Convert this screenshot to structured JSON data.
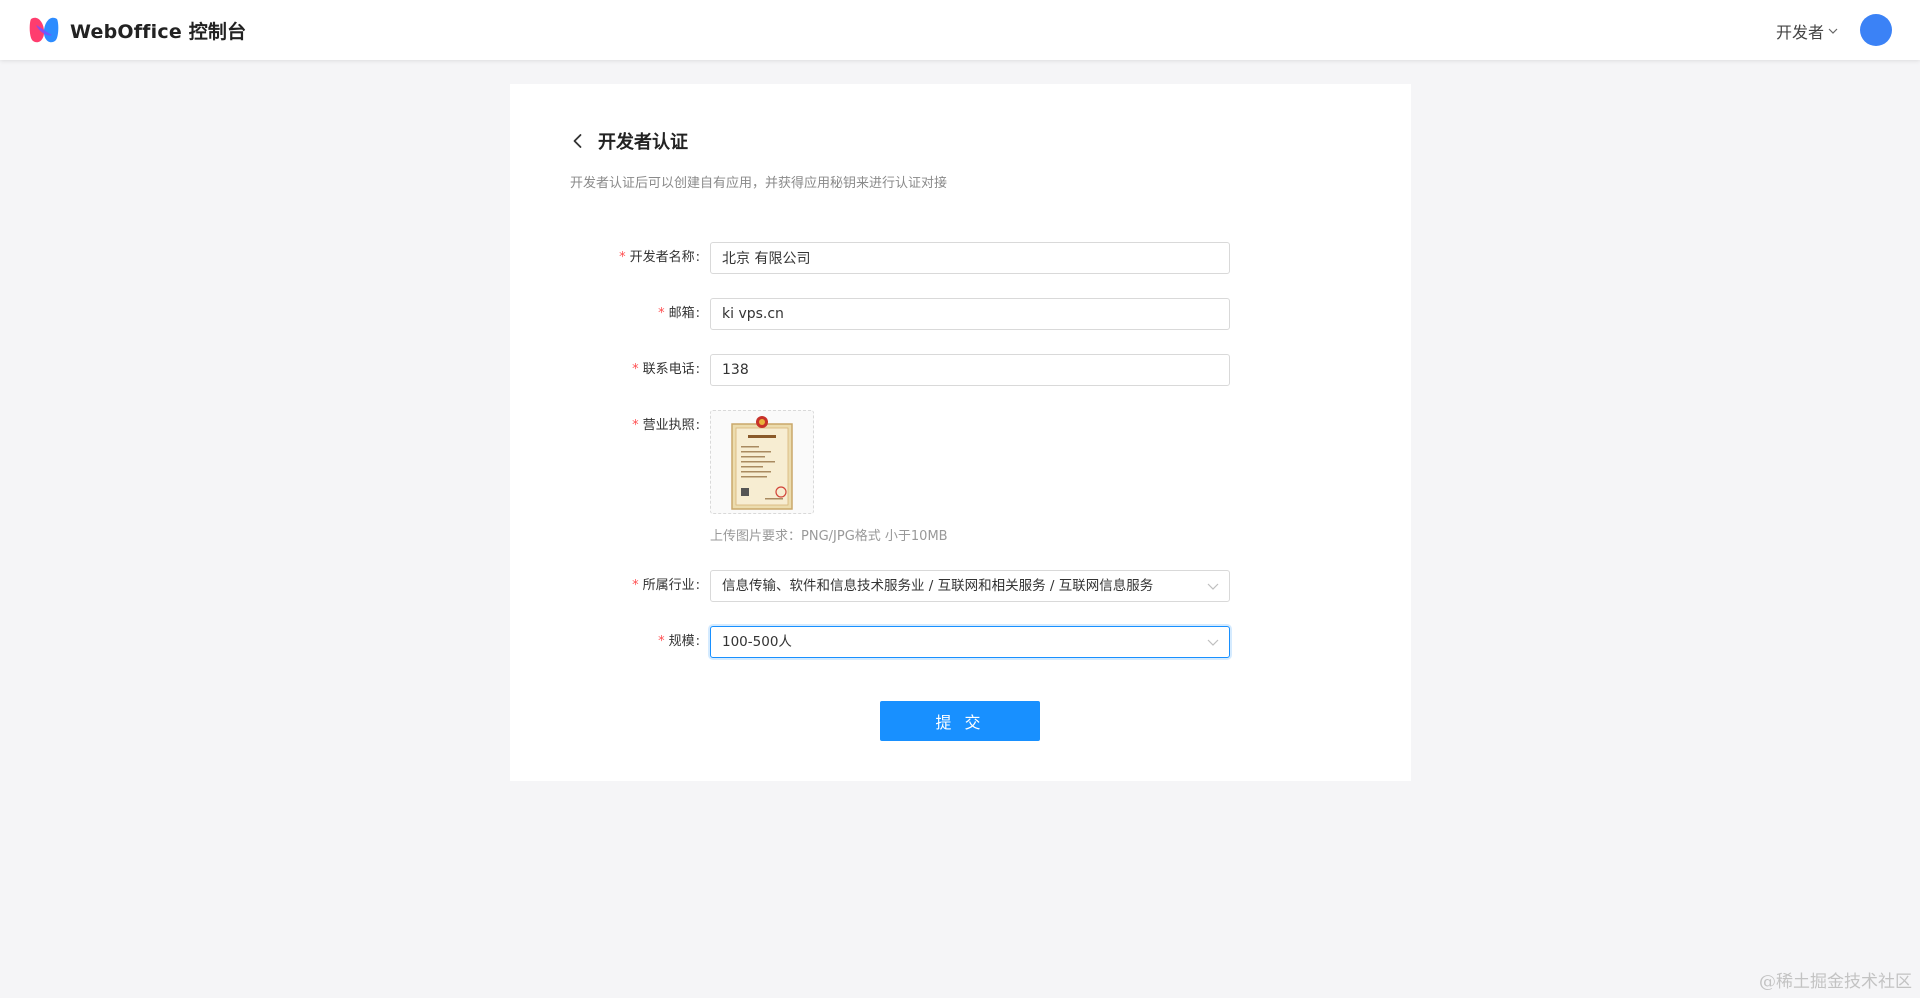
{
  "header": {
    "app_name": "WebOffice 控制台",
    "user_role": "开发者"
  },
  "page": {
    "title": "开发者认证",
    "subtitle": "开发者认证后可以创建自有应用，并获得应用秘钥来进行认证对接"
  },
  "form": {
    "required_mark": "*",
    "fields": [
      {
        "label": "开发者名称",
        "value": "北京 有限公司"
      },
      {
        "label": "邮箱",
        "value": "ki vps.cn"
      },
      {
        "label": "联系电话",
        "value": "138"
      },
      {
        "label": "营业执照",
        "upload_hint": "上传图片要求：PNG/JPG格式 小于10MB"
      },
      {
        "label": "所属行业",
        "value": "信息传输、软件和信息技术服务业 / 互联网和相关服务 / 互联网信息服务"
      },
      {
        "label": "规模",
        "value": "100-500人"
      }
    ],
    "submit_label": "提 交"
  },
  "watermark": "@稀土掘金技术社区",
  "colors": {
    "primary": "#1890ff",
    "required": "#ff4d4f",
    "avatar": "#3b82f6",
    "background": "#f5f5f7"
  },
  "icons": [
    "app-logo-icon",
    "chevron-down-icon",
    "back-arrow-icon",
    "license-image"
  ]
}
